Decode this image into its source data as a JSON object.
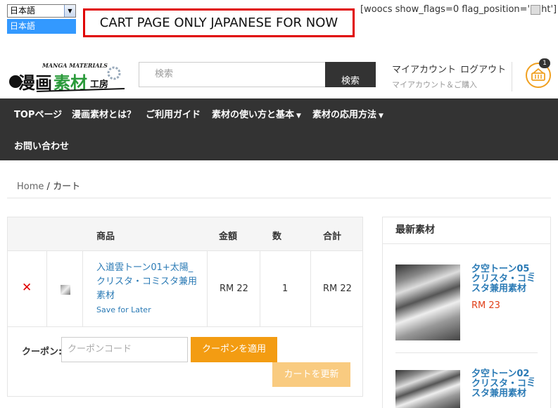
{
  "language_switcher": {
    "selected": "日本語",
    "options": [
      "日本語"
    ]
  },
  "notice_banner": "CART PAGE ONLY JAPANESE FOR NOW",
  "shortcode_text": {
    "before": "[woocs show_flags=0  flag_position='",
    "after": "ht']"
  },
  "header": {
    "logo_small_text": "MANGA MATERIALS",
    "logo_text_part1": "漫画",
    "logo_text_part2": "素材",
    "logo_text_part3": "工房",
    "search_placeholder": "検索",
    "search_button": "検索",
    "my_account": "マイアカウント",
    "logout": "ログアウト",
    "account_sub": "マイアカウント＆ご購入",
    "cart_count": "1"
  },
  "nav": {
    "items": [
      "TOPページ",
      "漫画素材とは？",
      "ご利用ガイド",
      "素材の使い方と基本",
      "素材の応用方法",
      "お問い合わせ"
    ]
  },
  "breadcrumb": {
    "home": "Home",
    "separator": "/",
    "current": "カート"
  },
  "cart": {
    "columns": [
      "商品",
      "金額",
      "数",
      "合計"
    ],
    "rows": [
      {
        "remove": "✕",
        "name": "入道雲トーン01+太陽_クリスタ・コミスタ兼用素材",
        "save_for_later": "Save for Later",
        "price": "RM 22",
        "quantity": "1",
        "total": "RM 22"
      }
    ],
    "coupon_label": "クーポン:",
    "coupon_placeholder": "クーポンコード",
    "apply_coupon": "クーポンを適用",
    "update_cart": "カートを更新"
  },
  "sidebar": {
    "title": "最新素材",
    "products": [
      {
        "name": "夕空トーン05_クリスタ・コミスタ兼用素材",
        "price": "RM 23"
      },
      {
        "name": "夕空トーン02_クリスタ・コミスタ兼用素材",
        "price": ""
      }
    ]
  },
  "colors": {
    "accent": "#f39c12",
    "nav_bg": "#333333",
    "link": "#2a7ab5",
    "price": "#e0401a",
    "notice_border": "#e00000"
  }
}
